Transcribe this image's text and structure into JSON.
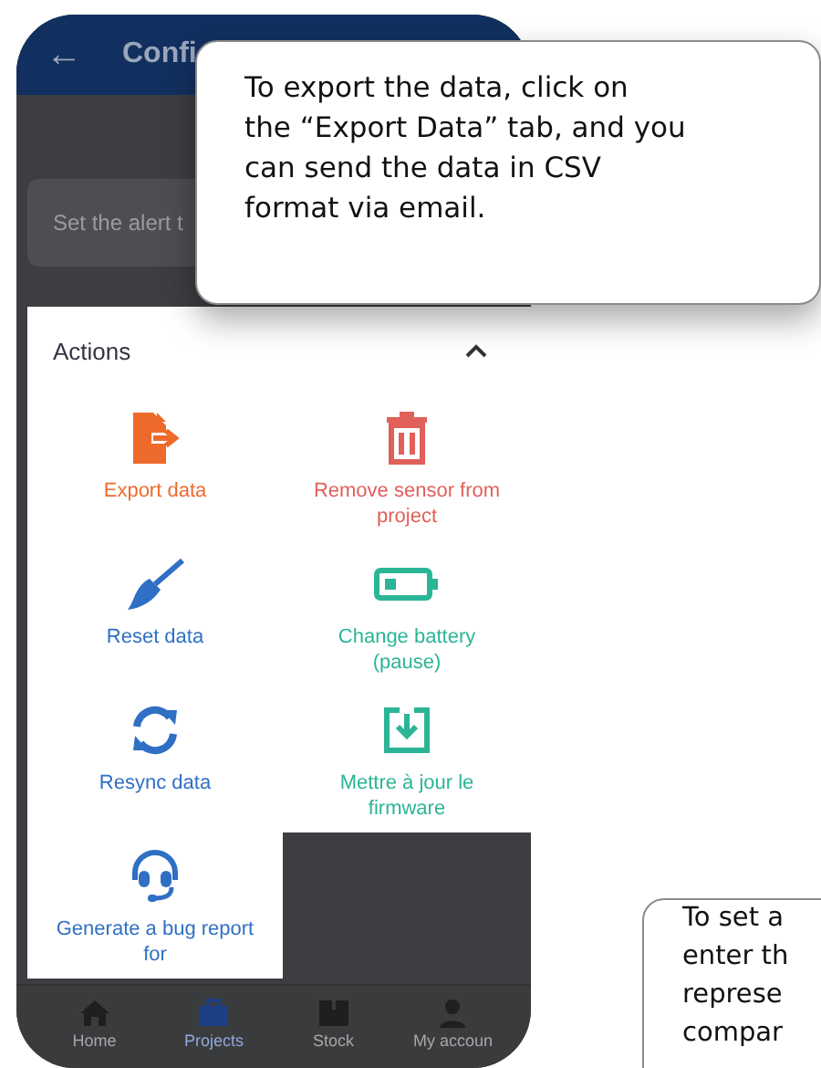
{
  "header": {
    "back_icon": "←",
    "title": "Confi"
  },
  "alert_card": {
    "text": "Set the alert t"
  },
  "actions": {
    "title": "Actions",
    "expanded": true,
    "items": [
      {
        "kind": "export",
        "label": "Export data",
        "color": "#ee6a2c"
      },
      {
        "kind": "remove",
        "label": "Remove sensor from project",
        "color": "#e0605a"
      },
      {
        "kind": "reset",
        "label": "Reset data",
        "color": "#2f6fc4"
      },
      {
        "kind": "battery",
        "label": "Change battery (pause)",
        "color": "#2bb596"
      },
      {
        "kind": "resync",
        "label": "Resync data",
        "color": "#2f6fc4"
      },
      {
        "kind": "firmware",
        "label": "Mettre à jour le firmware",
        "color": "#2bb596"
      },
      {
        "kind": "bug",
        "label": "Generate a bug report for",
        "color": "#2f6fc4"
      }
    ]
  },
  "bottom_nav": [
    {
      "kind": "home",
      "label": "Home",
      "selected": false
    },
    {
      "kind": "projects",
      "label": "Projects",
      "selected": true
    },
    {
      "kind": "stock",
      "label": "Stock",
      "selected": false
    },
    {
      "kind": "account",
      "label": "My accoun",
      "selected": false
    }
  ],
  "callouts": [
    {
      "kind": "main",
      "lines": [
        "To export the data, click on",
        "the “Export Data” tab, and you",
        "can send the data in CSV",
        "format via email."
      ]
    },
    {
      "kind": "edge",
      "lines": [
        "To set a",
        "enter th",
        "represe",
        "compar"
      ]
    }
  ]
}
